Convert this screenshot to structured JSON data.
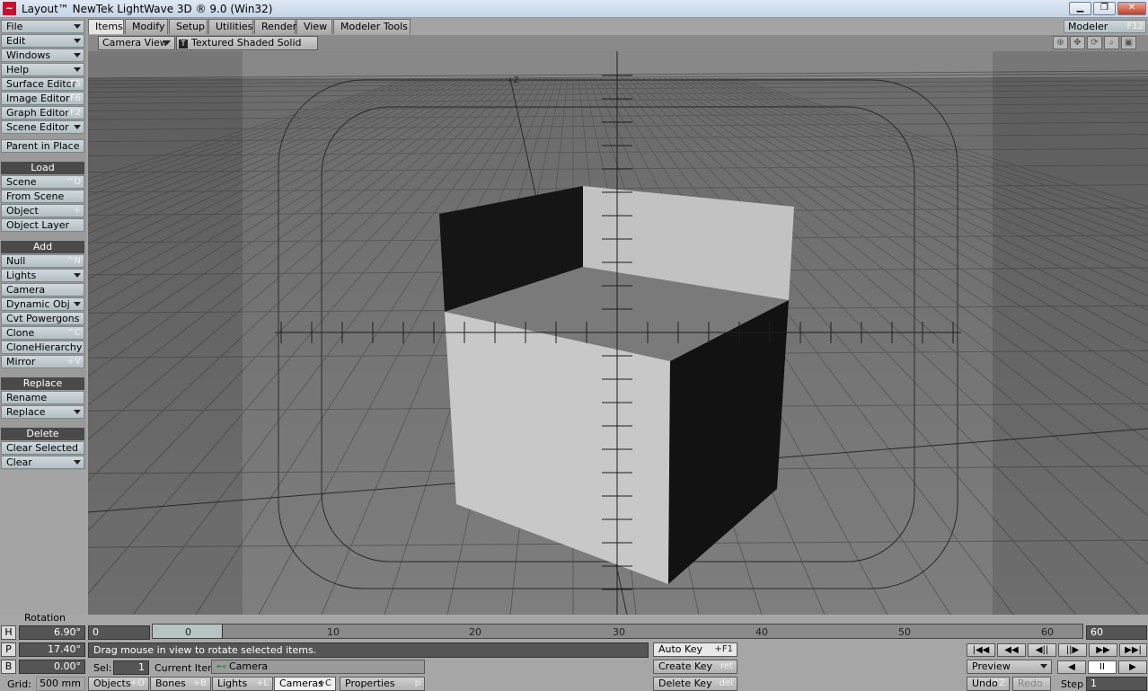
{
  "window": {
    "title": "Layout™ NewTek LightWave 3D ® 9.0 (Win32)",
    "minimize": "▁",
    "maximize": "❐",
    "close": "✕"
  },
  "menu": [
    {
      "label": "File",
      "dropdown": true
    },
    {
      "label": "Edit",
      "dropdown": true
    },
    {
      "label": "Windows",
      "dropdown": true
    },
    {
      "label": "Help",
      "dropdown": true
    },
    {
      "label": "Surface Editor",
      "shortcut": "F5"
    },
    {
      "label": "Image Editor",
      "shortcut": "F6"
    },
    {
      "label": "Graph Editor",
      "shortcut": "^F2"
    },
    {
      "label": "Scene Editor",
      "dropdown": true
    },
    {
      "label": "Parent in Place"
    }
  ],
  "load": {
    "header": "Load",
    "items": [
      {
        "label": "Scene",
        "shortcut": "^O"
      },
      {
        "label": "From Scene"
      },
      {
        "label": "Object",
        "shortcut": "+"
      },
      {
        "label": "Object Layer"
      }
    ]
  },
  "add": {
    "header": "Add",
    "items": [
      {
        "label": "Null",
        "shortcut": "^N"
      },
      {
        "label": "Lights",
        "dropdown": true
      },
      {
        "label": "Camera"
      },
      {
        "label": "Dynamic Obj",
        "dropdown": true
      },
      {
        "label": "Cvt Powergons"
      },
      {
        "label": "Clone",
        "shortcut": "^C"
      },
      {
        "label": "CloneHierarchy"
      },
      {
        "label": "Mirror",
        "shortcut": "+V"
      }
    ]
  },
  "replace": {
    "header": "Replace",
    "items": [
      {
        "label": "Rename"
      },
      {
        "label": "Replace",
        "dropdown": true
      }
    ]
  },
  "delete": {
    "header": "Delete",
    "items": [
      {
        "label": "Clear Selected",
        "shortcut": "-"
      },
      {
        "label": "Clear",
        "dropdown": true
      }
    ]
  },
  "tabs": [
    "Items",
    "Modify",
    "Setup",
    "Utilities",
    "Render",
    "View",
    "Modeler Tools"
  ],
  "active_tab": "Items",
  "modeler": {
    "label": "Modeler",
    "shortcut": "F12"
  },
  "viewport": {
    "view": "Camera View",
    "shading": "Textured Shaded Solid",
    "shading_icon": "T",
    "axis_marker": "+Z"
  },
  "rotation": {
    "title": "Rotation",
    "h": {
      "label": "H",
      "value": "6.90°"
    },
    "p": {
      "label": "P",
      "value": "17.40°"
    },
    "b": {
      "label": "B",
      "value": "0.00°"
    },
    "grid_label": "Grid:",
    "grid_value": "500 mm"
  },
  "timeline": {
    "start": "0",
    "end": "60",
    "current": "0",
    "ticks": [
      "0",
      "10",
      "20",
      "30",
      "40",
      "50",
      "60"
    ],
    "current_fraction": 0.0
  },
  "status_text": "Drag mouse in view to rotate selected items.",
  "sel": {
    "label": "Sel:",
    "value": "1"
  },
  "current_item": {
    "label": "Current Item",
    "value": "Camera"
  },
  "item_tabs": [
    {
      "label": "Objects",
      "shortcut": "+O"
    },
    {
      "label": "Bones",
      "shortcut": "+B"
    },
    {
      "label": "Lights",
      "shortcut": "+L"
    },
    {
      "label": "Cameras",
      "shortcut": "+C"
    },
    {
      "label": "Properties",
      "shortcut": "p"
    }
  ],
  "keys": {
    "auto": {
      "label": "Auto Key",
      "shortcut": "+F1"
    },
    "create": {
      "label": "Create Key",
      "shortcut": "ret"
    },
    "delete": {
      "label": "Delete Key",
      "shortcut": "del"
    }
  },
  "transport": {
    "preview": "Preview",
    "undo": "Undo",
    "undo_shortcut": "^Z",
    "redo": "Redo",
    "step_label": "Step",
    "step_value": "1"
  },
  "colors": {
    "viewport_bg": "#777777",
    "safe_area": "#5f5f5f",
    "status_bg": "#555555"
  }
}
